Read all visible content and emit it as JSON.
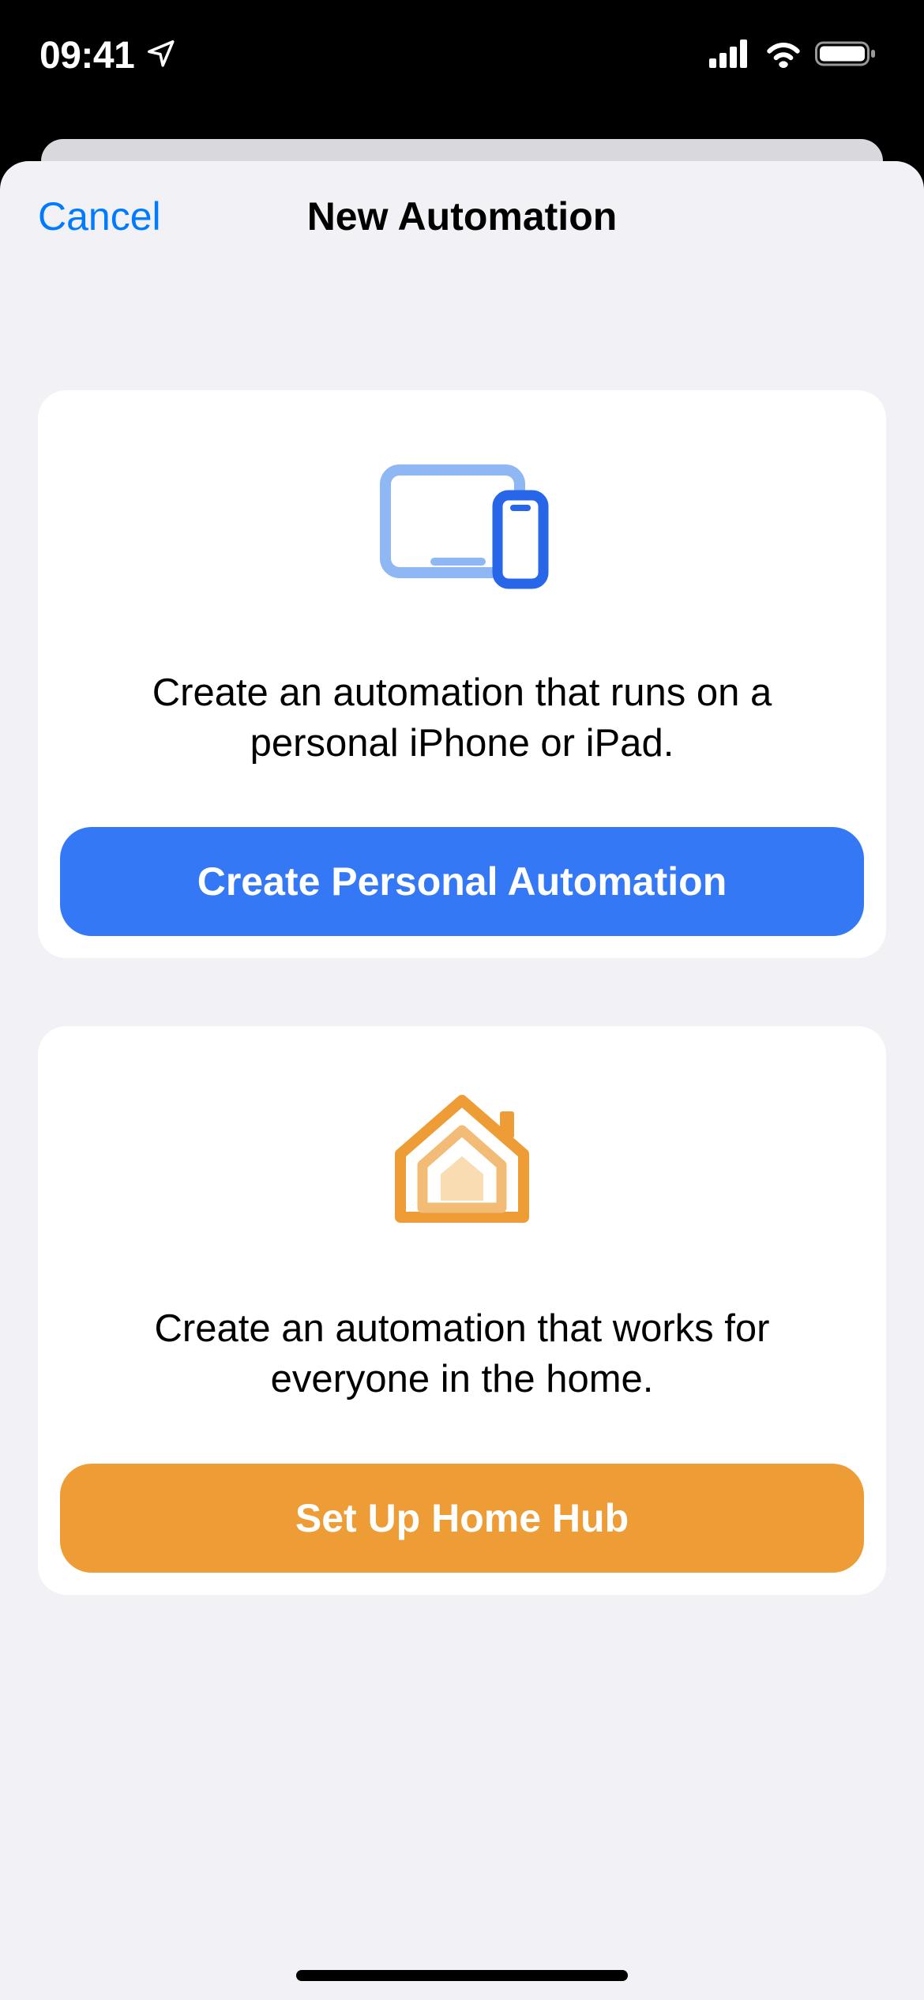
{
  "status": {
    "time": "09:41"
  },
  "nav": {
    "cancel": "Cancel",
    "title": "New Automation"
  },
  "cards": {
    "personal": {
      "description": "Create an automation that runs on a personal iPhone or iPad.",
      "button": "Create Personal Automation"
    },
    "home": {
      "description": "Create an automation that works for everyone in the home.",
      "button": "Set Up Home Hub"
    }
  }
}
